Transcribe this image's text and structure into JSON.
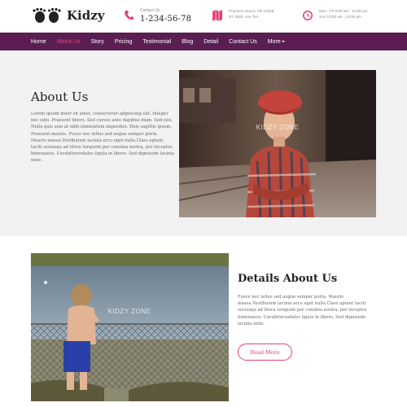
{
  "brand": {
    "name": "Kidzy",
    "logo_icon": "baby-feet-icon"
  },
  "header": {
    "contact": {
      "label": "Contact Us",
      "phone": "1-234-56-78",
      "icon": "phone-icon"
    },
    "address": {
      "lines": [
        "Praesent Libero, PB 12345,",
        "ST 1828, Any Tim"
      ],
      "icon": "map-icon"
    },
    "hours": {
      "lines": [
        "Mon - Fri 8:00 am - 12:00 pm",
        "Sun 10:00 am - 13:00 pm"
      ],
      "icon": "clock-icon"
    }
  },
  "nav": {
    "items": [
      "Home",
      "About Us",
      "Story",
      "Pricing",
      "Testimonial",
      "Blog",
      "Detail",
      "Contact Us",
      "More"
    ],
    "active": "About Us"
  },
  "about": {
    "title": "About Us",
    "text": "Lorem ipsum dolor sit amet, consectetur adipiscing elit. Integer nec odio. Praesent libero. Sed cursus ante dapibus diam. Sed nisi. Nulla quis sem at nibh elementum imperdiet. Duis sagittis ipsum. Praesent mauris. Fusce nec tellus sed augue semper porta. Mauris massa.Vestibulum lacinia arcu eget nulla.Class aptent taciti sociosqu ad litora torquent per conubia nostra, per inceptos himenaeos. Curabitursodales ligula in libero. Sed dignissim lacinia nunc.",
    "watermark": "KIDZY ZONE"
  },
  "details": {
    "title": "Details About Us",
    "text": "Fusce nec tellus sed augue semper porta. Mauris massa.Vestibulum lacinia arcu eget nulla.Class aptent taciti sociosqu ad litora torquent per conubia nostra, per inceptos himenaeos. Curabitursodales ligula in libero. Sed dignissim lacinia nunc.",
    "button": "Read More",
    "watermark": "KIDZY ZONE"
  },
  "colors": {
    "nav_bg": "#5a1e52",
    "accent": "#e8426f",
    "section_bg": "#f2f2f2"
  }
}
